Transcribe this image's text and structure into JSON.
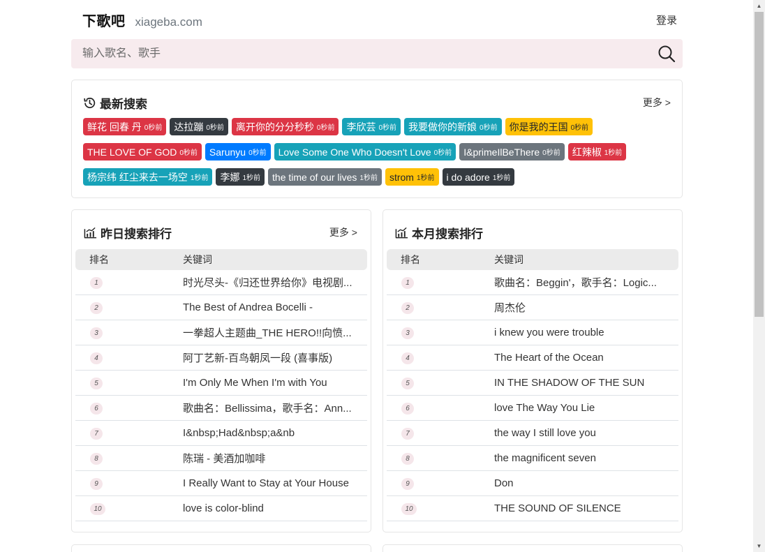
{
  "header": {
    "brand": "下歌吧",
    "domain": "xiageba.com",
    "login": "登录"
  },
  "search": {
    "placeholder": "输入歌名、歌手"
  },
  "recent": {
    "title": "最新搜索",
    "more": "更多 >",
    "tags": [
      {
        "text": "鲜花 回春 丹",
        "ago": "0秒前",
        "color": "red"
      },
      {
        "text": "达拉蹦",
        "ago": "0秒前",
        "color": "dark"
      },
      {
        "text": "离开你的分分秒秒",
        "ago": "0秒前",
        "color": "red"
      },
      {
        "text": "李欣芸",
        "ago": "0秒前",
        "color": "teal"
      },
      {
        "text": "我要做你的新娘",
        "ago": "0秒前",
        "color": "teal"
      },
      {
        "text": "你是我的王国",
        "ago": "0秒前",
        "color": "yellow"
      },
      {
        "text": "THE LOVE OF GOD",
        "ago": "0秒前",
        "color": "red"
      },
      {
        "text": "Sarunyu",
        "ago": "0秒前",
        "color": "blue"
      },
      {
        "text": "Love Some One Who Doesn't Love",
        "ago": "0秒前",
        "color": "teal"
      },
      {
        "text": "I&primeIlBeThere",
        "ago": "0秒前",
        "color": "gray"
      },
      {
        "text": "红辣椒",
        "ago": "1秒前",
        "color": "red"
      },
      {
        "text": "杨宗纬 红尘来去一场空",
        "ago": "1秒前",
        "color": "teal"
      },
      {
        "text": "李娜",
        "ago": "1秒前",
        "color": "dark"
      },
      {
        "text": "the time of our lives",
        "ago": "1秒前",
        "color": "gray"
      },
      {
        "text": "strom",
        "ago": "1秒前",
        "color": "yellow"
      },
      {
        "text": "i do adore",
        "ago": "1秒前",
        "color": "dark"
      }
    ]
  },
  "yesterday": {
    "title": "昨日搜索排行",
    "more": "更多 >",
    "col_rank": "排名",
    "col_keyword": "关键词",
    "rows": [
      {
        "rank": "1",
        "keyword": "时光尽头-《归还世界给你》电视剧..."
      },
      {
        "rank": "2",
        "keyword": "The Best of Andrea Bocelli -"
      },
      {
        "rank": "3",
        "keyword": "一拳超人主题曲_THE HERO!!向愤..."
      },
      {
        "rank": "4",
        "keyword": "阿丁艺新-百鸟朝凤一段 (喜事版)"
      },
      {
        "rank": "5",
        "keyword": "I'm Only Me When I'm with You"
      },
      {
        "rank": "6",
        "keyword": "歌曲名：Bellissima，歌手名：Ann..."
      },
      {
        "rank": "7",
        "keyword": "I&nbsp;Had&nbsp;a&nb"
      },
      {
        "rank": "8",
        "keyword": "陈瑞 - 美酒加咖啡"
      },
      {
        "rank": "9",
        "keyword": "I Really Want to Stay at Your House"
      },
      {
        "rank": "10",
        "keyword": "love is color-blind"
      }
    ]
  },
  "month": {
    "title": "本月搜索排行",
    "col_rank": "排名",
    "col_keyword": "关键词",
    "rows": [
      {
        "rank": "1",
        "keyword": "歌曲名：Beggin'，歌手名：Logic..."
      },
      {
        "rank": "2",
        "keyword": "周杰伦"
      },
      {
        "rank": "3",
        "keyword": "i knew you were trouble"
      },
      {
        "rank": "4",
        "keyword": "The Heart of the Ocean"
      },
      {
        "rank": "5",
        "keyword": "IN THE SHADOW OF THE SUN"
      },
      {
        "rank": "6",
        "keyword": "love The Way You Lie"
      },
      {
        "rank": "7",
        "keyword": "the way I still love you"
      },
      {
        "rank": "8",
        "keyword": "the magnificent seven"
      },
      {
        "rank": "9",
        "keyword": "Don"
      },
      {
        "rank": "10",
        "keyword": "THE SOUND OF SILENCE"
      }
    ]
  },
  "colors": {
    "red": "#dc3545",
    "dark": "#343a40",
    "teal": "#17a2b8",
    "blue": "#007bff",
    "gray": "#6c757d",
    "yellow": "#ffc107"
  },
  "icons": {
    "search": "search-icon",
    "history": "history-icon",
    "chart": "chart-icon"
  }
}
